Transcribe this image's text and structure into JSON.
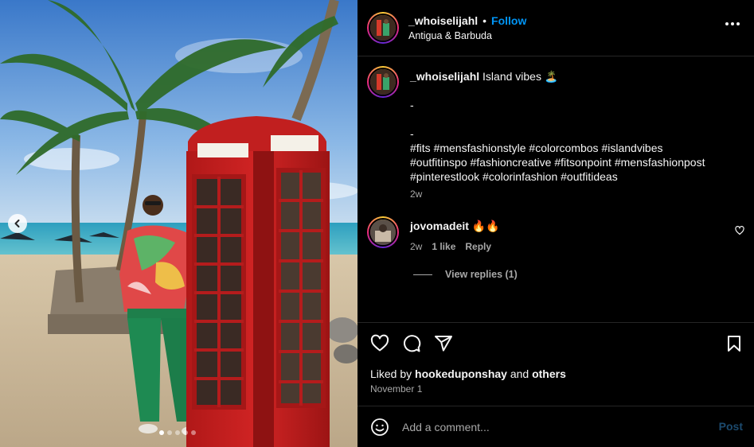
{
  "post": {
    "author": "_whoiselijahl",
    "separator": "•",
    "follow_label": "Follow",
    "location": "Antigua & Barbuda",
    "caption_text": "Island vibes",
    "caption_emoji": "🏝️",
    "caption_lines": [
      "-",
      "-"
    ],
    "hashtag_lines": [
      "#fits #mensfashionstyle #colorcombos #islandvibes",
      "#outfitinspo #fashioncreative #fitsonpoint #mensfashionpost",
      "#pinterestlook #colorinfashion #outfitideas"
    ],
    "caption_time": "2w",
    "photo_icon": "telephone-booth-beach-photo",
    "carousel_dots": 5,
    "carousel_active": 0
  },
  "comment": {
    "author": "jovomadeit",
    "text": "🔥🔥",
    "time": "2w",
    "likes": "1 like",
    "reply_label": "Reply",
    "view_replies": "View replies (1)"
  },
  "footer": {
    "liked_by_prefix": "Liked by",
    "liked_by_user": "hookeduponshay",
    "liked_by_and": "and",
    "liked_by_others": "others",
    "date": "November 1",
    "comment_placeholder": "Add a comment...",
    "post_label": "Post"
  },
  "colors": {
    "accent": "#0095f6",
    "background": "#000000",
    "muted": "#a8a8a8",
    "post_disabled": "#1c4a6e"
  },
  "icons": [
    "chevron-left-icon",
    "more-icon",
    "heart-icon",
    "comment-icon",
    "share-icon",
    "bookmark-icon",
    "emoji-icon"
  ]
}
